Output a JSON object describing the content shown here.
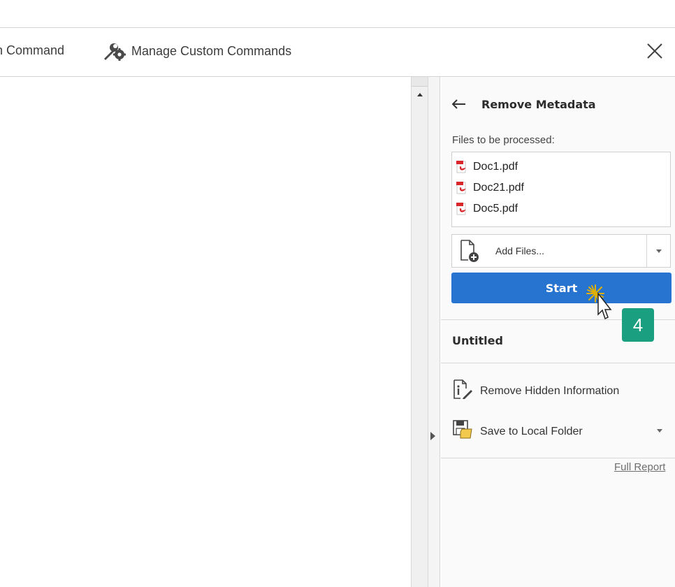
{
  "toolbar": {
    "new_command_partial": "n Command",
    "manage_custom_commands": "Manage Custom Commands"
  },
  "panel": {
    "title": "Remove Metadata",
    "files_label": "Files to be processed:",
    "files": [
      {
        "name": "Doc1.pdf"
      },
      {
        "name": "Doc21.pdf"
      },
      {
        "name": "Doc5.pdf"
      }
    ],
    "add_files_label": "Add Files...",
    "start_label": "Start",
    "step_badge": "4",
    "untitled_label": "Untitled",
    "remove_hidden_info": "Remove Hidden Information",
    "save_to_local_folder": "Save to Local Folder",
    "full_report": "Full Report"
  },
  "colors": {
    "start_button": "#2773d0",
    "step_badge": "#1aa080"
  },
  "icons": {
    "back": "back-arrow-icon",
    "wrench_gear": "wrench-gear-icon",
    "close": "close-icon",
    "pdf": "pdf-file-icon",
    "add_file": "add-file-icon",
    "info_doc": "info-document-icon",
    "save_folder": "save-folder-icon"
  }
}
